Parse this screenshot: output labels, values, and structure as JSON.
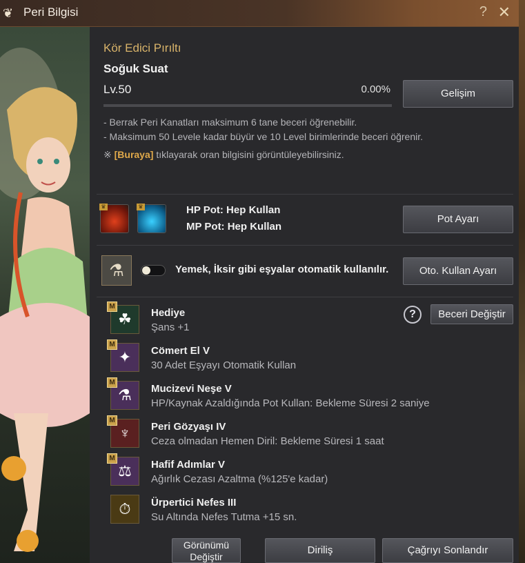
{
  "window": {
    "title": "Peri Bilgisi",
    "help_glyph": "?",
    "close_glyph": "✕"
  },
  "peri": {
    "name": "Kör Edici Pırıltı",
    "subtitle": "Soğuk Suat",
    "level_prefix": "Lv.",
    "level": "50",
    "progress_text": "0.00%",
    "progress_fraction": 0.0,
    "evolve_button": "Gelişim"
  },
  "info": {
    "line1": "- Berrak Peri Kanatları maksimum 6 tane beceri öğrenebilir.",
    "line2": "- Maksimum 50 Levele kadar büyür ve 10 Level birimlerinde beceri öğrenir.",
    "line3_mark": "※",
    "line3_link": "[Buraya]",
    "line3_rest": "tıklayarak oran bilgisini görüntüleyebilirsiniz."
  },
  "pots": {
    "hp_label": "HP Pot: Hep Kullan",
    "mp_label": "MP Pot: Hep Kullan",
    "settings_button": "Pot Ayarı",
    "crown_glyph": "♛"
  },
  "auto_use": {
    "text": "Yemek, İksir gibi eşyalar otomatik kullanılır.",
    "toggle_on": false,
    "settings_button": "Oto. Kullan Ayarı"
  },
  "skills_header": {
    "help_glyph": "?",
    "change_button": "Beceri Değiştir"
  },
  "skills": [
    {
      "title": "Hediye",
      "desc": "Şans +1",
      "badge": "M",
      "icon": "clover-icon",
      "glyph": "☘",
      "color": "#1f3a2c"
    },
    {
      "title": "Cömert El V",
      "desc": "30 Adet Eşyayı Otomatik Kullan",
      "badge": "M",
      "icon": "fairy-icon",
      "glyph": "✦",
      "color": "#4a2f5a"
    },
    {
      "title": "Mucizevi Neşe V",
      "desc": "HP/Kaynak Azaldığında Pot Kullan: Bekleme Süresi 2 saniye",
      "badge": "M",
      "icon": "potion-icon",
      "glyph": "⚗",
      "color": "#4a2f5a"
    },
    {
      "title": "Peri Gözyaşı IV",
      "desc": "Ceza olmadan Hemen Diril: Bekleme Süresi 1 saat",
      "badge": "M",
      "icon": "tear-icon",
      "glyph": "♆",
      "color": "#5a2020"
    },
    {
      "title": "Hafif Adımlar V",
      "desc": "Ağırlık Cezası Azaltma (%125'e kadar)",
      "badge": "M",
      "icon": "weight-icon",
      "glyph": "⚖",
      "color": "#4a2f5a"
    },
    {
      "title": "Ürpertici Nefes III",
      "desc": "Su Altında Nefes Tutma +15 sn.",
      "badge": "",
      "icon": "breath-icon",
      "glyph": "⏱",
      "color": "#4a3a14"
    }
  ],
  "footer": {
    "appearance_button_line1": "Görünümü",
    "appearance_button_line2": "Değiştir",
    "revive_button": "Diriliş",
    "dismiss_button": "Çağrıyı Sonlandır"
  }
}
